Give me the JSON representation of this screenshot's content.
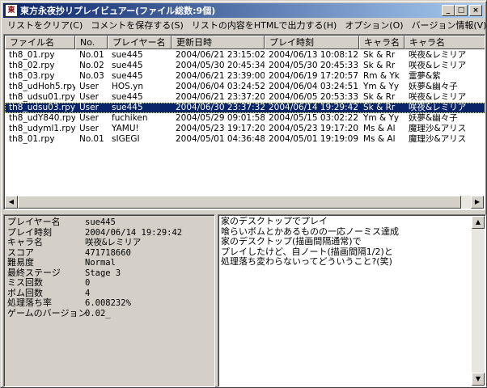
{
  "window": {
    "icon_text": "東",
    "title": "東方永夜抄リプレイビュアー(ファイル総数:9個)",
    "buttons": [
      "_",
      "□",
      "×"
    ]
  },
  "menu": [
    "リストをクリア(C)",
    "コメントを保存する(S)",
    "リストの内容をHTMLで出力する(H)",
    "オプション(O)",
    "バージョン情報(V)"
  ],
  "list": {
    "columns": [
      "ファイル名",
      "No.",
      "プレイヤー名",
      "更新日時",
      "プレイ時刻",
      "キャラ名",
      "キャラ名"
    ],
    "rows": [
      {
        "file": "th8_01.rpy",
        "no": "No.01",
        "player": "sue445",
        "updated": "2004/06/21 23:15:02",
        "played": "2004/06/13 10:08:12",
        "chara": "Sk & Rr",
        "chara_full": "咲夜&レミリア"
      },
      {
        "file": "th8_02.rpy",
        "no": "No.02",
        "player": "sue445",
        "updated": "2004/05/30 20:45:34",
        "played": "2004/05/30 20:45:33",
        "chara": "Sk & Rr",
        "chara_full": "咲夜&レミリア"
      },
      {
        "file": "th8_03.rpy",
        "no": "No.03",
        "player": "sue445",
        "updated": "2004/06/21 23:39:00",
        "played": "2004/06/19 17:20:57",
        "chara": "Rm & Yk",
        "chara_full": "霊夢&紫"
      },
      {
        "file": "th8_udHoh5.rpy",
        "no": "User",
        "player": "HOS.yn",
        "updated": "2004/06/04 03:24:52",
        "played": "2004/06/04 03:24:51",
        "chara": "Ym & Yy",
        "chara_full": "妖夢&幽々子"
      },
      {
        "file": "th8_udsu01.rpy",
        "no": "User",
        "player": "sue445",
        "updated": "2004/06/21 23:37:20",
        "played": "2004/06/05 20:53:33",
        "chara": "Sk & Rr",
        "chara_full": "咲夜&レミリア"
      },
      {
        "file": "th8_udsu03.rpy",
        "no": "User",
        "player": "sue445",
        "updated": "2004/06/30 23:37:32",
        "played": "2004/06/14 19:29:42",
        "chara": "Sk & Rr",
        "chara_full": "咲夜&レミリア"
      },
      {
        "file": "th8_udY840.rpy",
        "no": "User",
        "player": "fuchiken",
        "updated": "2004/05/29 09:01:58",
        "played": "2004/05/15 03:02:22",
        "chara": "Ym & Yy",
        "chara_full": "妖夢&幽々子"
      },
      {
        "file": "th8_udyml1.rpy",
        "no": "User",
        "player": "YAMU!",
        "updated": "2004/05/23 19:17:20",
        "played": "2004/05/23 19:17:20",
        "chara": "Ms & Al",
        "chara_full": "魔理沙&アリス"
      },
      {
        "file": "th8_01.rpy",
        "no": "No.01",
        "player": "sIGEGI",
        "updated": "2004/05/01 04:36:48",
        "played": "2004/05/01 19:19:09",
        "chara": "Ms & Al",
        "chara_full": "魔理沙&アリス"
      }
    ],
    "selected_index": 5
  },
  "details": [
    {
      "label": "プレイヤー名",
      "value": "sue445"
    },
    {
      "label": "プレイ時刻",
      "value": "2004/06/14 19:29:42"
    },
    {
      "label": "キャラ名",
      "value": "咲夜&レミリア"
    },
    {
      "label": "スコア",
      "value": "471718660"
    },
    {
      "label": "難易度",
      "value": "Normal"
    },
    {
      "label": "最終ステージ",
      "value": "Stage 3"
    },
    {
      "label": "ミス回数",
      "value": "0"
    },
    {
      "label": "ボム回数",
      "value": "4"
    },
    {
      "label": "処理落ち率",
      "value": "6.008232%"
    },
    {
      "label": "ゲームのバージョン",
      "value": "0.02_"
    }
  ],
  "comment": [
    "家のデスクトップでプレイ",
    "喰らいボムとかあるものの一応ノーミス達成",
    "家のデスクトップ(描画間隔通常)で",
    "プレイしたけど、自ノート(描画間隔1/2)と",
    "処理落ち変わらないってどういうこと?(笑)"
  ]
}
